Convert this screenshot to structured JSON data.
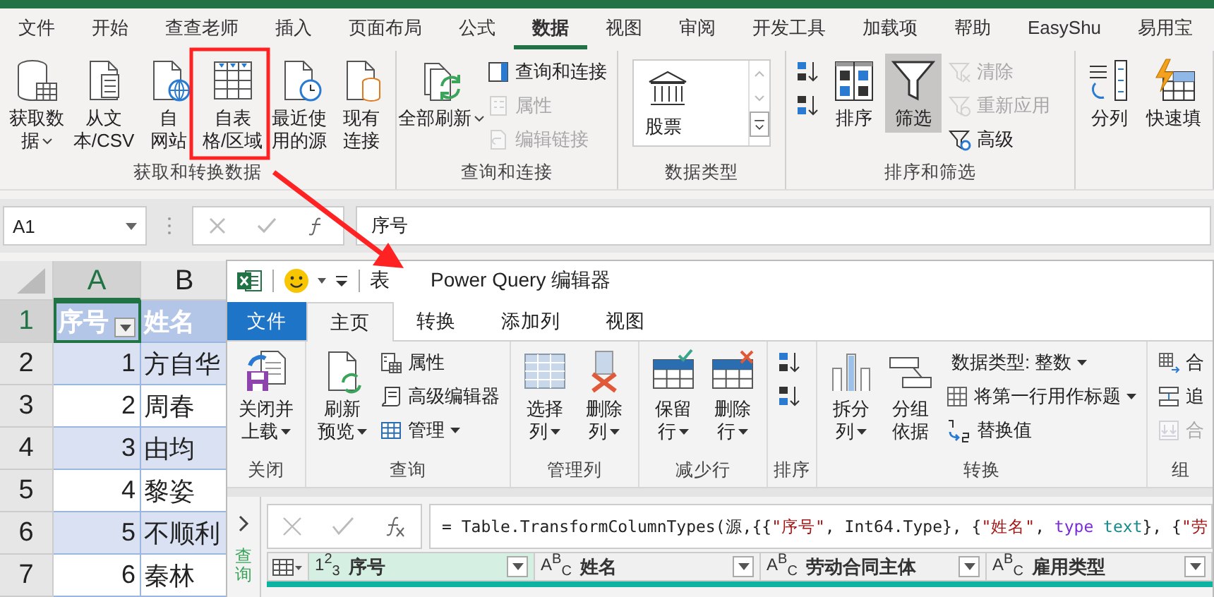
{
  "excel": {
    "menu_tabs": [
      {
        "label": "文件",
        "selected": false
      },
      {
        "label": "开始",
        "selected": false
      },
      {
        "label": "查查老师",
        "selected": false
      },
      {
        "label": "插入",
        "selected": false
      },
      {
        "label": "页面布局",
        "selected": false
      },
      {
        "label": "公式",
        "selected": false
      },
      {
        "label": "数据",
        "selected": true
      },
      {
        "label": "视图",
        "selected": false
      },
      {
        "label": "审阅",
        "selected": false
      },
      {
        "label": "开发工具",
        "selected": false
      },
      {
        "label": "加载项",
        "selected": false
      },
      {
        "label": "帮助",
        "selected": false
      },
      {
        "label": "EasyShu",
        "selected": false
      },
      {
        "label": "易用宝",
        "selected": false
      }
    ],
    "ribbon": [
      {
        "label": "获取和转换数据",
        "items": [
          {
            "kind": "large",
            "lines": [
              "获取数",
              "据"
            ],
            "dropdown": true,
            "on": false
          },
          {
            "kind": "large",
            "lines": [
              "从文",
              "本/CSV"
            ],
            "dropdown": false,
            "on": false
          },
          {
            "kind": "large",
            "lines": [
              "自",
              "网站"
            ],
            "dropdown": false,
            "on": false
          },
          {
            "kind": "large",
            "lines": [
              "自表",
              "格/区域"
            ],
            "dropdown": false,
            "on": false
          },
          {
            "kind": "large",
            "lines": [
              "最近使",
              "用的源"
            ],
            "dropdown": false,
            "on": false
          },
          {
            "kind": "large",
            "lines": [
              "现有",
              "连接"
            ],
            "dropdown": false,
            "on": false
          }
        ]
      },
      {
        "label": "查询和连接",
        "items": [
          {
            "kind": "large",
            "lines": [
              "全部刷新"
            ],
            "dropdown": true,
            "on": false
          },
          {
            "kind": "stack",
            "items": [
              {
                "label": "查询和连接",
                "disabled": false
              },
              {
                "label": "属性",
                "disabled": true
              },
              {
                "label": "编辑链接",
                "disabled": true
              }
            ]
          }
        ]
      },
      {
        "label": "数据类型",
        "items": [
          {
            "kind": "gallery",
            "label": "股票"
          }
        ]
      },
      {
        "label": "排序和筛选",
        "items": [
          {
            "kind": "stack",
            "items": [
              {
                "disabled": false
              },
              {
                "disabled": false
              }
            ]
          },
          {
            "kind": "large",
            "lines": [
              "排序"
            ],
            "dropdown": false,
            "on": false
          },
          {
            "kind": "large",
            "lines": [
              "筛选"
            ],
            "dropdown": false,
            "on": true
          },
          {
            "kind": "stack",
            "items": [
              {
                "label": "清除",
                "disabled": true
              },
              {
                "label": "重新应用",
                "disabled": true
              },
              {
                "label": "高级",
                "disabled": false
              }
            ]
          }
        ]
      },
      {
        "items": [
          {
            "kind": "large",
            "lines": [
              "分列"
            ],
            "dropdown": false,
            "on": false
          },
          {
            "kind": "large",
            "lines": [
              "快速填"
            ],
            "dropdown": false,
            "on": false
          }
        ]
      }
    ],
    "name_box": "A1",
    "formula": "序号",
    "columns": [
      {
        "label": "A"
      },
      {
        "label": "B"
      }
    ],
    "rows": [
      {
        "number": "1",
        "kind": "header",
        "cells": [
          {
            "text": "序号",
            "selected": true
          },
          {
            "text": "姓名",
            "selected": false
          }
        ]
      },
      {
        "number": "2",
        "kind": "data",
        "cells": [
          {
            "text": "1",
            "selected": false
          },
          {
            "text": "方自华",
            "selected": false
          }
        ]
      },
      {
        "number": "3",
        "kind": "data",
        "cells": [
          {
            "text": "2",
            "selected": false
          },
          {
            "text": "周春",
            "selected": false
          }
        ]
      },
      {
        "number": "4",
        "kind": "data",
        "cells": [
          {
            "text": "3",
            "selected": false
          },
          {
            "text": "由均",
            "selected": false
          }
        ]
      },
      {
        "number": "5",
        "kind": "data",
        "cells": [
          {
            "text": "4",
            "selected": false
          },
          {
            "text": "黎姿",
            "selected": false
          }
        ]
      },
      {
        "number": "6",
        "kind": "data",
        "cells": [
          {
            "text": "5",
            "selected": false
          },
          {
            "text": "不顺利",
            "selected": false
          }
        ]
      },
      {
        "number": "7",
        "kind": "data",
        "cells": [
          {
            "text": "6",
            "selected": false
          },
          {
            "text": "秦林",
            "selected": false
          }
        ]
      }
    ]
  },
  "power_query": {
    "title_parts": [
      "表",
      "Power Query 编辑器"
    ],
    "tabs": [
      {
        "label": "文件",
        "kind": "file",
        "selected": false
      },
      {
        "label": "主页",
        "kind": "tab",
        "selected": true
      },
      {
        "label": "转换",
        "kind": "tab",
        "selected": false
      },
      {
        "label": "添加列",
        "kind": "tab",
        "selected": false
      },
      {
        "label": "视图",
        "kind": "tab",
        "selected": false
      }
    ],
    "ribbon": [
      {
        "label": "关闭",
        "items": [
          {
            "kind": "large",
            "lines": [
              "关闭并",
              "上载"
            ],
            "dropdown": true,
            "on": false
          }
        ]
      },
      {
        "label": "查询",
        "items": [
          {
            "kind": "large",
            "lines": [
              "刷新",
              "预览"
            ],
            "dropdown": true,
            "on": false
          },
          {
            "kind": "stack",
            "items": [
              {
                "label": "属性",
                "disabled": false
              },
              {
                "label": "高级编辑器",
                "disabled": false
              },
              {
                "label": "管理",
                "disabled": false,
                "dropdown": true
              }
            ]
          }
        ]
      },
      {
        "label": "管理列",
        "items": [
          {
            "kind": "large",
            "lines": [
              "选择",
              "列"
            ],
            "dropdown": true,
            "on": false
          },
          {
            "kind": "large",
            "lines": [
              "删除",
              "列"
            ],
            "dropdown": true,
            "on": false
          }
        ]
      },
      {
        "label": "减少行",
        "items": [
          {
            "kind": "large",
            "lines": [
              "保留",
              "行"
            ],
            "dropdown": true,
            "on": false
          },
          {
            "kind": "large",
            "lines": [
              "删除",
              "行"
            ],
            "dropdown": true,
            "on": false
          }
        ]
      },
      {
        "label": "排序",
        "items": [
          {
            "kind": "stack",
            "items": [
              {
                "disabled": false
              },
              {
                "disabled": false
              }
            ]
          }
        ]
      },
      {
        "label": "转换",
        "items": [
          {
            "kind": "large",
            "lines": [
              "拆分",
              "列"
            ],
            "dropdown": true,
            "on": false
          },
          {
            "kind": "large",
            "lines": [
              "分组",
              "依据"
            ],
            "dropdown": false,
            "on": false
          },
          {
            "kind": "stack",
            "items": [
              {
                "label": "数据类型: 整数",
                "disabled": false,
                "dropdown": true
              },
              {
                "label": "将第一行用作标题",
                "disabled": false,
                "dropdown": true
              },
              {
                "label": "替换值",
                "disabled": false
              }
            ]
          }
        ]
      },
      {
        "label": "组",
        "items": [
          {
            "kind": "stack",
            "items": [
              {
                "label": "合",
                "disabled": false
              },
              {
                "label": "追",
                "disabled": false
              },
              {
                "label": "合",
                "disabled": true
              }
            ]
          }
        ]
      }
    ],
    "side_panel": {
      "label": "查询"
    },
    "formula_tokens": [
      {
        "text": "= Table.TransformColumnTypes(源,{{",
        "kind": "plain"
      },
      {
        "text": "\"序号\"",
        "kind": "string"
      },
      {
        "text": ", Int64.Type}, {",
        "kind": "plain"
      },
      {
        "text": "\"姓名\"",
        "kind": "string"
      },
      {
        "text": ", ",
        "kind": "plain"
      },
      {
        "text": "type",
        "kind": "keyword"
      },
      {
        "text": " text",
        "kind": "type"
      },
      {
        "text": "}, {",
        "kind": "plain"
      },
      {
        "text": "\"劳",
        "kind": "string"
      }
    ],
    "columns": [
      {
        "type": "1$^{2}$$_{3}$",
        "name": "序号",
        "selected": true
      },
      {
        "type": "A$^{B}$$_{C}$",
        "name": "姓名",
        "selected": false
      },
      {
        "type": "A$^{B}$$_{C}$",
        "name": "劳动合同主体",
        "selected": false
      },
      {
        "type": "A$^{B}$$_{C}$",
        "name": "雇用类型",
        "selected": false
      }
    ]
  }
}
